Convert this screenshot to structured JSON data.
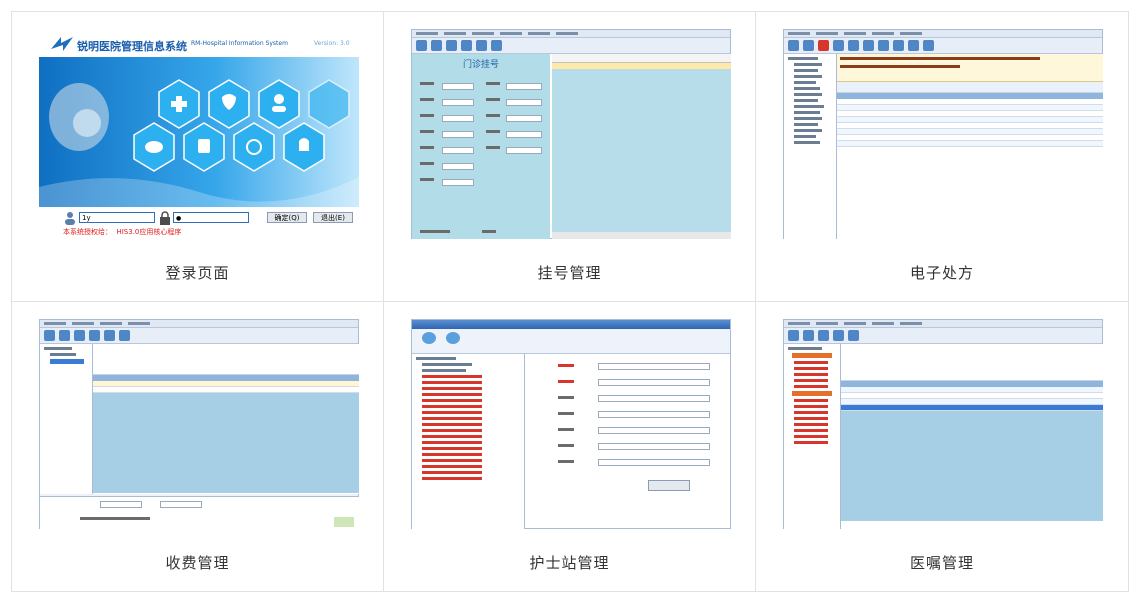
{
  "modules": [
    {
      "id": "login",
      "caption": "登录页面",
      "screen": {
        "brand": "锐明医院管理信息系统",
        "brand_en": "RM-Hospital Information System",
        "version": "Version: 3.0",
        "user_value": "1y",
        "password_value": "●",
        "ok_button": "确定(Q)",
        "exit_button": "退出(E)",
        "license": "本系统授权给：  HIS3.0应用核心程序"
      }
    },
    {
      "id": "register",
      "caption": "挂号管理",
      "screen": {
        "title": "门诊挂号"
      }
    },
    {
      "id": "prescription",
      "caption": "电子处方",
      "screen": {}
    },
    {
      "id": "billing",
      "caption": "收费管理",
      "screen": {}
    },
    {
      "id": "nurse",
      "caption": "护士站管理",
      "screen": {}
    },
    {
      "id": "orders",
      "caption": "医嘱管理",
      "screen": {}
    }
  ],
  "colors": {
    "border": "#e2e2e2",
    "caption": "#333333",
    "login_bg": "#1d8fd6",
    "hex": "#2cb0f0",
    "license_red": "#e01c1c"
  }
}
